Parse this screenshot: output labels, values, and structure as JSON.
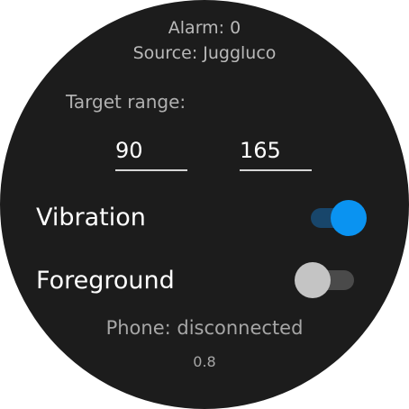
{
  "status": {
    "alarm": "Alarm: 0",
    "source": "Source: Juggluco"
  },
  "target_range": {
    "label": "Target range:",
    "low": "90",
    "high": "165"
  },
  "settings": {
    "vibration": {
      "label": "Vibration",
      "enabled": true
    },
    "foreground": {
      "label": "Foreground",
      "enabled": false
    }
  },
  "footer": {
    "phone_status": "Phone: disconnected",
    "version": "0.8"
  },
  "colors": {
    "background": "#1c1c1c",
    "accent": "#0a93f1",
    "accent_track": "#18466b",
    "off_thumb": "#c4c4c4",
    "off_track": "#4a4a4a"
  }
}
